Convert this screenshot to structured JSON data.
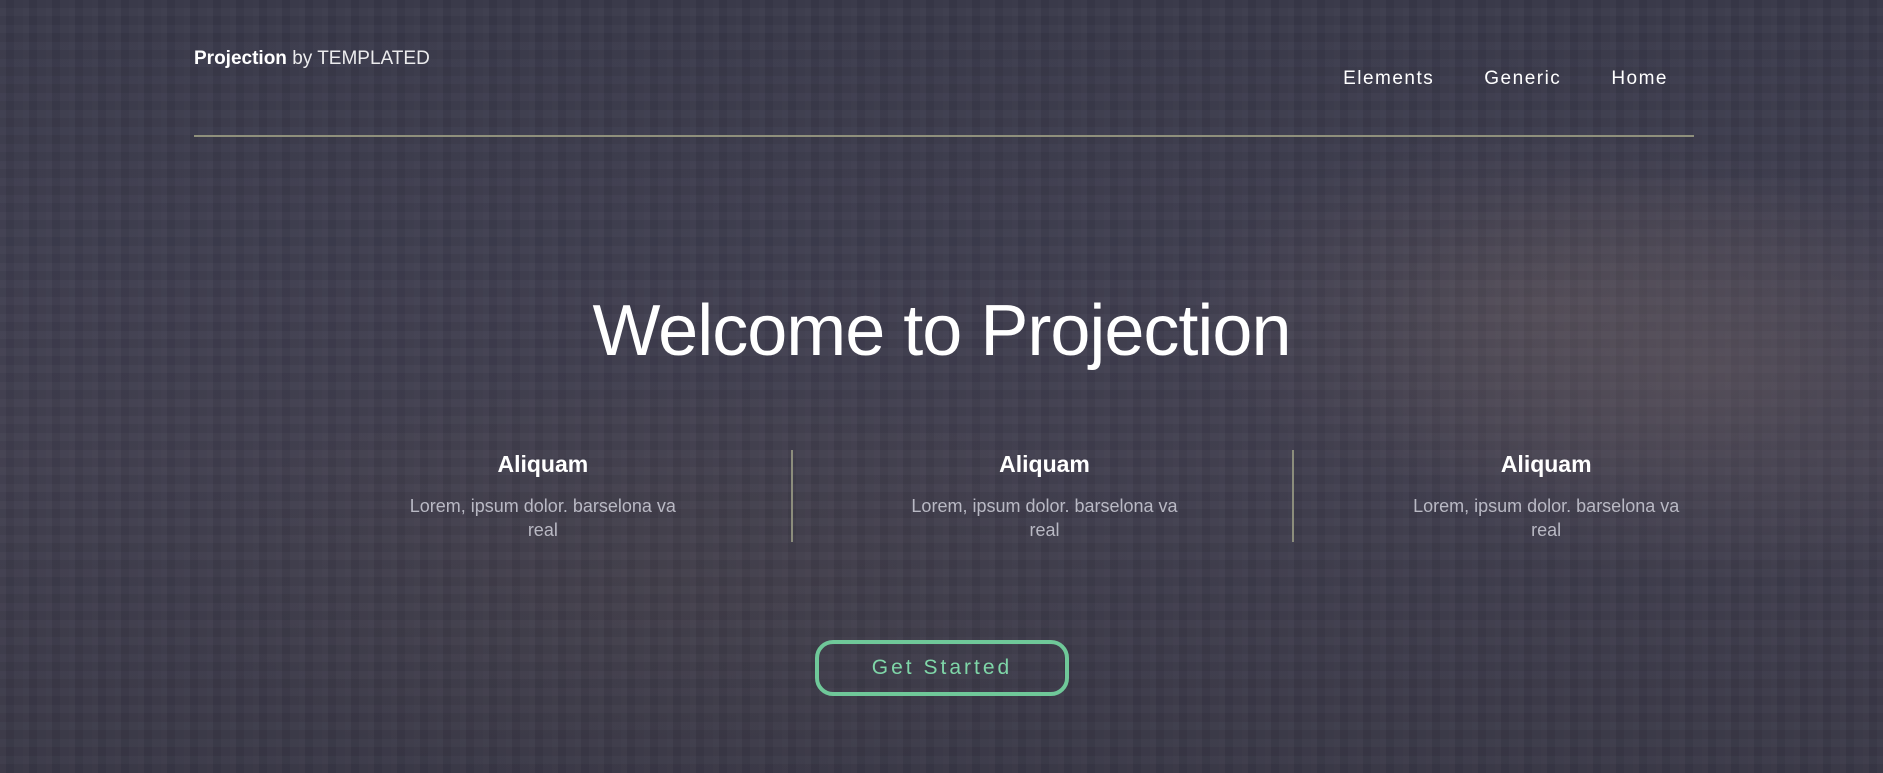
{
  "header": {
    "brand_name": "Projection",
    "brand_by": "by TEMPLATED",
    "nav": [
      {
        "label": "Elements"
      },
      {
        "label": "Generic"
      },
      {
        "label": "Home"
      }
    ]
  },
  "hero": {
    "headline": "Welcome to Projection",
    "features": [
      {
        "title": "Aliquam",
        "desc": "Lorem, ipsum dolor. barselona va real"
      },
      {
        "title": "Aliquam",
        "desc": "Lorem, ipsum dolor. barselona va real"
      },
      {
        "title": "Aliquam",
        "desc": "Lorem, ipsum dolor. barselona va real"
      }
    ],
    "cta_label": "Get Started"
  },
  "colors": {
    "accent": "#6fc899",
    "overlay": "#343244",
    "divider": "#8f907c"
  }
}
